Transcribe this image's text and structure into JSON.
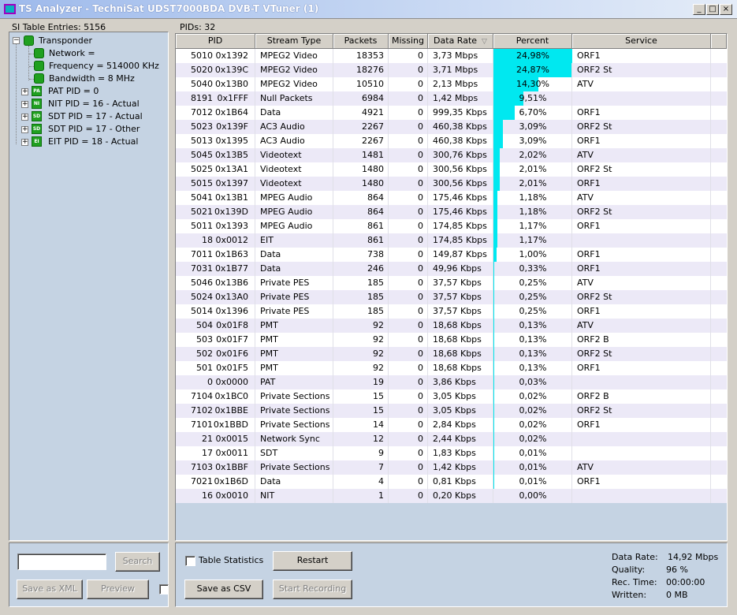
{
  "window": {
    "title": "TS Analyzer - TechniSat UDST7000BDA DVB-T VTuner (1)",
    "min": "_",
    "max": "□",
    "close": "×"
  },
  "si_panel": {
    "label": "SI Table Entries: 5156"
  },
  "pids_panel": {
    "label": "PIDs: 32"
  },
  "tree": {
    "root": "Transponder",
    "items": [
      {
        "label": "Network =",
        "kind": "led"
      },
      {
        "label": "Frequency = 514000 KHz",
        "kind": "led"
      },
      {
        "label": "Bandwidth = 8 MHz",
        "kind": "led"
      },
      {
        "label": "PAT PID = 0",
        "kind": "table",
        "tag": "PAT"
      },
      {
        "label": "NIT PID = 16 - Actual",
        "kind": "table",
        "tag": "NIT"
      },
      {
        "label": "SDT PID = 17 - Actual",
        "kind": "table",
        "tag": "SDT"
      },
      {
        "label": "SDT PID = 17 - Other",
        "kind": "table",
        "tag": "SDT"
      },
      {
        "label": "EIT PID = 18 - Actual",
        "kind": "table",
        "tag": "EIT"
      }
    ]
  },
  "columns": [
    "PID",
    "Stream Type",
    "Packets",
    "Missing",
    "Data Rate",
    "Percent",
    "Service"
  ],
  "sort_indicator": "▽",
  "rows": [
    {
      "pid": "5010",
      "hex": "0x1392",
      "type": "MPEG2 Video",
      "packets": "18353",
      "missing": "0",
      "rate": "3,73 Mbps",
      "percent": "24,98%",
      "pct": 24.98,
      "service": "ORF1"
    },
    {
      "pid": "5020",
      "hex": "0x139C",
      "type": "MPEG2 Video",
      "packets": "18276",
      "missing": "0",
      "rate": "3,71 Mbps",
      "percent": "24,87%",
      "pct": 24.87,
      "service": "ORF2 St"
    },
    {
      "pid": "5040",
      "hex": "0x13B0",
      "type": "MPEG2 Video",
      "packets": "10510",
      "missing": "0",
      "rate": "2,13 Mbps",
      "percent": "14,30%",
      "pct": 14.3,
      "service": "ATV"
    },
    {
      "pid": "8191",
      "hex": "0x1FFF",
      "type": "Null Packets",
      "packets": "6984",
      "missing": "0",
      "rate": "1,42 Mbps",
      "percent": "9,51%",
      "pct": 9.51,
      "service": ""
    },
    {
      "pid": "7012",
      "hex": "0x1B64",
      "type": "Data",
      "packets": "4921",
      "missing": "0",
      "rate": "999,35 Kbps",
      "percent": "6,70%",
      "pct": 6.7,
      "service": "ORF1"
    },
    {
      "pid": "5023",
      "hex": "0x139F",
      "type": "AC3 Audio",
      "packets": "2267",
      "missing": "0",
      "rate": "460,38 Kbps",
      "percent": "3,09%",
      "pct": 3.09,
      "service": "ORF2 St"
    },
    {
      "pid": "5013",
      "hex": "0x1395",
      "type": "AC3 Audio",
      "packets": "2267",
      "missing": "0",
      "rate": "460,38 Kbps",
      "percent": "3,09%",
      "pct": 3.09,
      "service": "ORF1"
    },
    {
      "pid": "5045",
      "hex": "0x13B5",
      "type": "Videotext",
      "packets": "1481",
      "missing": "0",
      "rate": "300,76 Kbps",
      "percent": "2,02%",
      "pct": 2.02,
      "service": "ATV"
    },
    {
      "pid": "5025",
      "hex": "0x13A1",
      "type": "Videotext",
      "packets": "1480",
      "missing": "0",
      "rate": "300,56 Kbps",
      "percent": "2,01%",
      "pct": 2.01,
      "service": "ORF2 St"
    },
    {
      "pid": "5015",
      "hex": "0x1397",
      "type": "Videotext",
      "packets": "1480",
      "missing": "0",
      "rate": "300,56 Kbps",
      "percent": "2,01%",
      "pct": 2.01,
      "service": "ORF1"
    },
    {
      "pid": "5041",
      "hex": "0x13B1",
      "type": "MPEG Audio",
      "packets": "864",
      "missing": "0",
      "rate": "175,46 Kbps",
      "percent": "1,18%",
      "pct": 1.18,
      "service": "ATV"
    },
    {
      "pid": "5021",
      "hex": "0x139D",
      "type": "MPEG Audio",
      "packets": "864",
      "missing": "0",
      "rate": "175,46 Kbps",
      "percent": "1,18%",
      "pct": 1.18,
      "service": "ORF2 St"
    },
    {
      "pid": "5011",
      "hex": "0x1393",
      "type": "MPEG Audio",
      "packets": "861",
      "missing": "0",
      "rate": "174,85 Kbps",
      "percent": "1,17%",
      "pct": 1.17,
      "service": "ORF1"
    },
    {
      "pid": "18",
      "hex": "0x0012",
      "type": "EIT",
      "packets": "861",
      "missing": "0",
      "rate": "174,85 Kbps",
      "percent": "1,17%",
      "pct": 1.17,
      "service": ""
    },
    {
      "pid": "7011",
      "hex": "0x1B63",
      "type": "Data",
      "packets": "738",
      "missing": "0",
      "rate": "149,87 Kbps",
      "percent": "1,00%",
      "pct": 1.0,
      "service": "ORF1"
    },
    {
      "pid": "7031",
      "hex": "0x1B77",
      "type": "Data",
      "packets": "246",
      "missing": "0",
      "rate": "49,96 Kbps",
      "percent": "0,33%",
      "pct": 0.33,
      "service": "ORF1"
    },
    {
      "pid": "5046",
      "hex": "0x13B6",
      "type": "Private PES",
      "packets": "185",
      "missing": "0",
      "rate": "37,57 Kbps",
      "percent": "0,25%",
      "pct": 0.25,
      "service": "ATV"
    },
    {
      "pid": "5024",
      "hex": "0x13A0",
      "type": "Private PES",
      "packets": "185",
      "missing": "0",
      "rate": "37,57 Kbps",
      "percent": "0,25%",
      "pct": 0.25,
      "service": "ORF2 St"
    },
    {
      "pid": "5014",
      "hex": "0x1396",
      "type": "Private PES",
      "packets": "185",
      "missing": "0",
      "rate": "37,57 Kbps",
      "percent": "0,25%",
      "pct": 0.25,
      "service": "ORF1"
    },
    {
      "pid": "504",
      "hex": "0x01F8",
      "type": "PMT",
      "packets": "92",
      "missing": "0",
      "rate": "18,68 Kbps",
      "percent": "0,13%",
      "pct": 0.13,
      "service": "ATV"
    },
    {
      "pid": "503",
      "hex": "0x01F7",
      "type": "PMT",
      "packets": "92",
      "missing": "0",
      "rate": "18,68 Kbps",
      "percent": "0,13%",
      "pct": 0.13,
      "service": "ORF2 B"
    },
    {
      "pid": "502",
      "hex": "0x01F6",
      "type": "PMT",
      "packets": "92",
      "missing": "0",
      "rate": "18,68 Kbps",
      "percent": "0,13%",
      "pct": 0.13,
      "service": "ORF2 St"
    },
    {
      "pid": "501",
      "hex": "0x01F5",
      "type": "PMT",
      "packets": "92",
      "missing": "0",
      "rate": "18,68 Kbps",
      "percent": "0,13%",
      "pct": 0.13,
      "service": "ORF1"
    },
    {
      "pid": "0",
      "hex": "0x0000",
      "type": "PAT",
      "packets": "19",
      "missing": "0",
      "rate": "3,86 Kbps",
      "percent": "0,03%",
      "pct": 0.03,
      "service": ""
    },
    {
      "pid": "7104",
      "hex": "0x1BC0",
      "type": "Private Sections",
      "packets": "15",
      "missing": "0",
      "rate": "3,05 Kbps",
      "percent": "0,02%",
      "pct": 0.02,
      "service": "ORF2 B"
    },
    {
      "pid": "7102",
      "hex": "0x1BBE",
      "type": "Private Sections",
      "packets": "15",
      "missing": "0",
      "rate": "3,05 Kbps",
      "percent": "0,02%",
      "pct": 0.02,
      "service": "ORF2 St"
    },
    {
      "pid": "7101",
      "hex": "0x1BBD",
      "type": "Private Sections",
      "packets": "14",
      "missing": "0",
      "rate": "2,84 Kbps",
      "percent": "0,02%",
      "pct": 0.02,
      "service": "ORF1"
    },
    {
      "pid": "21",
      "hex": "0x0015",
      "type": "Network Sync",
      "packets": "12",
      "missing": "0",
      "rate": "2,44 Kbps",
      "percent": "0,02%",
      "pct": 0.02,
      "service": ""
    },
    {
      "pid": "17",
      "hex": "0x0011",
      "type": "SDT",
      "packets": "9",
      "missing": "0",
      "rate": "1,83 Kbps",
      "percent": "0,01%",
      "pct": 0.01,
      "service": ""
    },
    {
      "pid": "7103",
      "hex": "0x1BBF",
      "type": "Private Sections",
      "packets": "7",
      "missing": "0",
      "rate": "1,42 Kbps",
      "percent": "0,01%",
      "pct": 0.01,
      "service": "ATV"
    },
    {
      "pid": "7021",
      "hex": "0x1B6D",
      "type": "Data",
      "packets": "4",
      "missing": "0",
      "rate": "0,81 Kbps",
      "percent": "0,01%",
      "pct": 0.01,
      "service": "ORF1"
    },
    {
      "pid": "16",
      "hex": "0x0010",
      "type": "NIT",
      "packets": "1",
      "missing": "0",
      "rate": "0,20 Kbps",
      "percent": "0,00%",
      "pct": 0.0,
      "service": ""
    }
  ],
  "left_controls": {
    "search_value": "",
    "search_button": "Search",
    "save_xml": "Save as XML",
    "preview": "Preview"
  },
  "right_controls": {
    "table_statistics": "Table Statistics",
    "restart": "Restart",
    "save_csv": "Save as CSV",
    "start_recording": "Start Recording"
  },
  "stats": {
    "data_rate_label": "Data Rate:",
    "data_rate": "14,92 Mbps",
    "quality_label": "Quality:",
    "quality": "96 %",
    "rec_time_label": "Rec. Time:",
    "rec_time": "00:00:00",
    "written_label": "Written:",
    "written": "0 MB"
  },
  "colors": {
    "bar": "#00e8f0",
    "grid_bg": "#c5d3e3",
    "row_even": "#ece9f7",
    "led": "#20a020"
  }
}
